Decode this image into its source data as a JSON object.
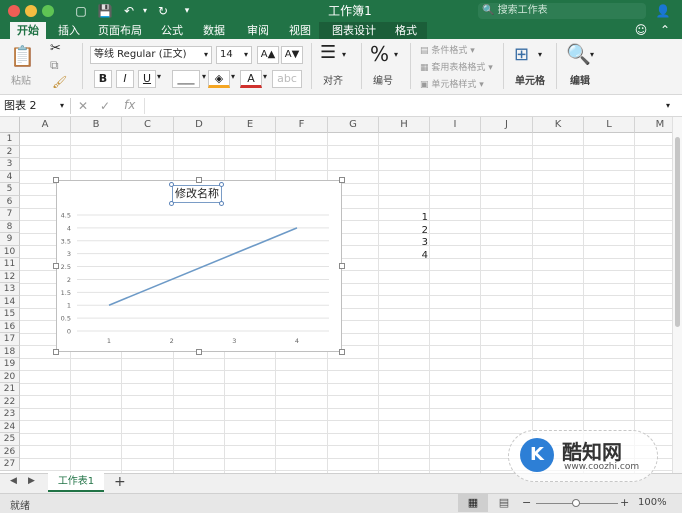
{
  "window": {
    "title": "工作簿1",
    "search_placeholder": "搜索工作表"
  },
  "tabs": [
    {
      "label": "开始",
      "active": true
    },
    {
      "label": "插入"
    },
    {
      "label": "页面布局"
    },
    {
      "label": "公式"
    },
    {
      "label": "数据"
    },
    {
      "label": "审阅"
    },
    {
      "label": "视图"
    },
    {
      "label": "图表设计"
    },
    {
      "label": "格式"
    }
  ],
  "ribbon": {
    "paste_label": "粘贴",
    "font_name": "等线 Regular (正文)",
    "font_size": "14",
    "grow_font": "A▲",
    "shrink_font": "A▼",
    "bold": "B",
    "italic": "I",
    "underline": "U",
    "align_label": "对齐",
    "number_label": "编号",
    "number_glyph": "%",
    "conditional_format": "条件格式",
    "table_format": "套用表格格式",
    "cell_styles": "单元格样式",
    "cells_label": "单元格",
    "edit_label": "编辑"
  },
  "formula_bar": {
    "name_box": "图表 2",
    "fx": "fx",
    "value": ""
  },
  "columns": [
    "A",
    "B",
    "C",
    "D",
    "E",
    "F",
    "G",
    "H",
    "I",
    "J",
    "K",
    "L",
    "M"
  ],
  "rows": [
    "1",
    "2",
    "3",
    "4",
    "5",
    "6",
    "7",
    "8",
    "9",
    "10",
    "11",
    "12",
    "13",
    "14",
    "15",
    "16",
    "17",
    "18",
    "19",
    "20",
    "21",
    "22",
    "23",
    "24",
    "25",
    "26",
    "27"
  ],
  "cells": {
    "H7": "1",
    "H8": "2",
    "H9": "3",
    "H10": "4"
  },
  "chart_data": {
    "type": "line",
    "title": "修改名称",
    "categories": [
      "1",
      "2",
      "3",
      "4"
    ],
    "x": [
      1,
      2,
      3,
      4
    ],
    "series": [
      {
        "values": [
          1,
          2,
          3,
          4
        ]
      }
    ],
    "y_ticks": [
      "0",
      "0.5",
      "1",
      "1.5",
      "2",
      "2.5",
      "3",
      "3.5",
      "4",
      "4.5"
    ],
    "ylim": [
      0,
      4.5
    ],
    "grid": true,
    "line_color": "#6d9ac7"
  },
  "sheets": [
    {
      "label": "工作表1",
      "active": true
    }
  ],
  "add_sheet": "+",
  "status": {
    "ready": "就绪",
    "zoom": "100%",
    "zoom_minus": "−",
    "zoom_plus": "+"
  },
  "watermark": {
    "brand": "酷知网",
    "url": "www.coozhi.com"
  },
  "colors": {
    "accent": "#217346",
    "chart_title_border": "#7a9cc6"
  }
}
